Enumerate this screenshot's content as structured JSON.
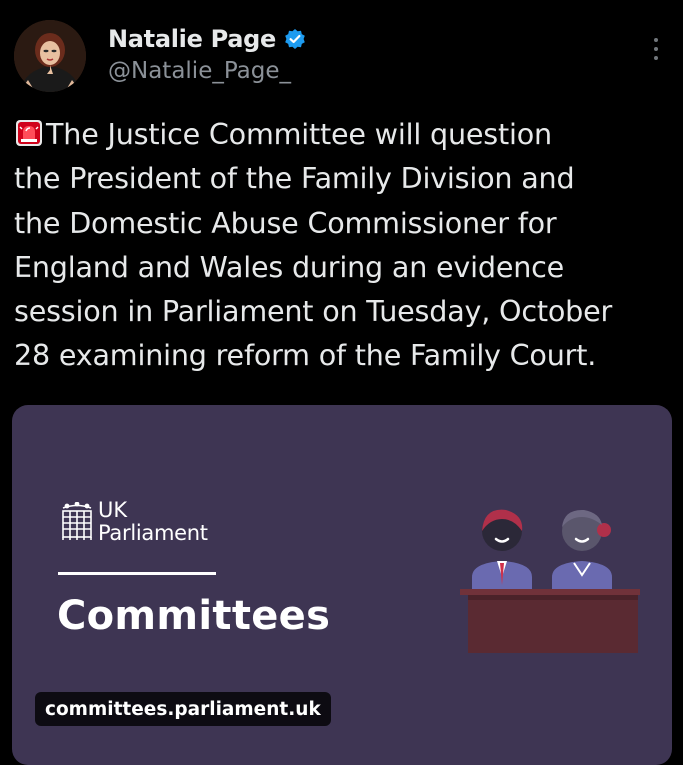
{
  "author": {
    "display_name": "Natalie Page",
    "handle": "@Natalie_Page_",
    "verified": true
  },
  "tweet": {
    "leading_emoji": "siren-emoji",
    "text": "The Justice Committee will question\nthe President of the Family Division and\nthe Domestic Abuse Commissioner for\nEngland and Wales during an evidence\nsession in Parliament on Tuesday, October\n28 examining reform of the Family Court."
  },
  "card": {
    "brand_line1": "UK",
    "brand_line2": "Parliament",
    "heading": "Committees",
    "domain": "committees.parliament.uk",
    "background_color": "#3e3553"
  },
  "icons": {
    "verified": "verified-badge-icon",
    "more": "more-options-icon",
    "brand": "portcullis-icon"
  },
  "colors": {
    "background": "#000000",
    "text_primary": "#e7e9ea",
    "text_secondary": "#8b9198",
    "verified_blue": "#1d9bf0"
  }
}
